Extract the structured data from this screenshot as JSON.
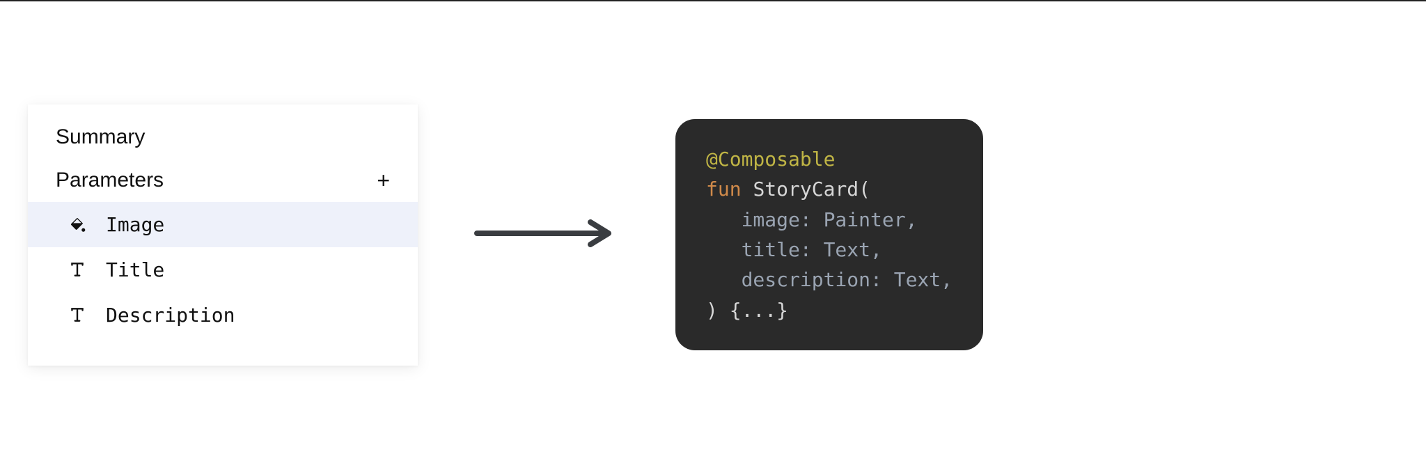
{
  "panel": {
    "summary_label": "Summary",
    "parameters_label": "Parameters",
    "add_label": "+",
    "items": [
      {
        "label": "Image",
        "icon": "image-fill-icon",
        "selected": true
      },
      {
        "label": "Title",
        "icon": "text-type-icon",
        "selected": false
      },
      {
        "label": "Description",
        "icon": "text-type-icon",
        "selected": false
      }
    ]
  },
  "code": {
    "annotation": "@Composable",
    "keyword_fun": "fun",
    "func_name": "StoryCard",
    "open_paren": "(",
    "params": [
      {
        "name": "image",
        "type": "Painter"
      },
      {
        "name": "title",
        "type": "Text"
      },
      {
        "name": "description",
        "type": "Text"
      }
    ],
    "close_line": ") {...}"
  }
}
